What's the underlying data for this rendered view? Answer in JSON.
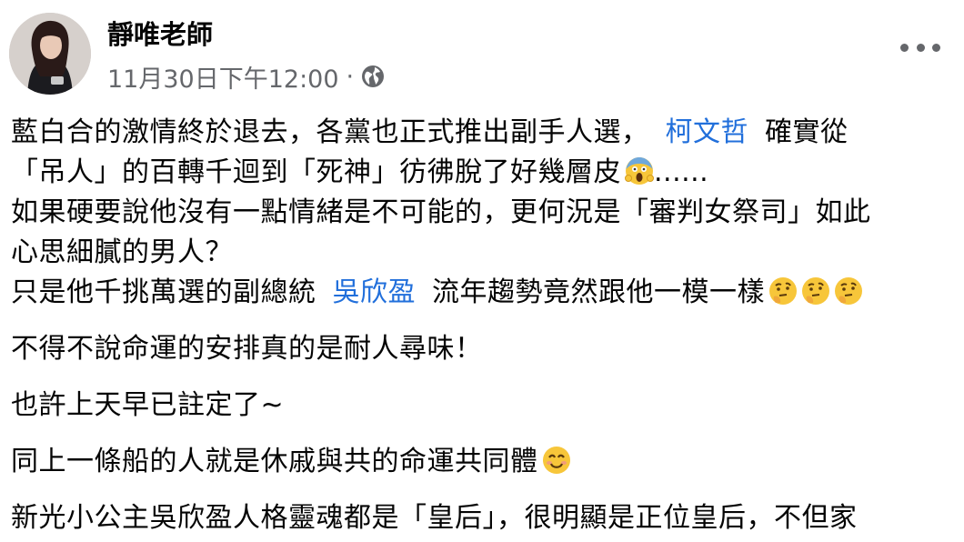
{
  "post": {
    "author": "靜唯老師",
    "timestamp": "11月30日下午12:00",
    "separator": "·",
    "privacy_icon": "globe-icon",
    "more_icon": "more-options-icon"
  },
  "content": {
    "l1_a": "藍白合的激情終於退去，各黨也正式推出副手人選，",
    "mention1": "柯文哲",
    "l1_b": "確實從",
    "l2_a": "「吊人」的百轉千迴到「死神」彷彿脫了好幾層皮",
    "l2_emoji": "face-screaming-in-fear",
    "l2_b": "......",
    "l3": "如果硬要說他沒有一點情緒是不可能的，更何況是「審判女祭司」如此",
    "l4": "心思細膩的男人？",
    "l5_a": "只是他千挑萬選的副總統",
    "mention2": "吳欣盈",
    "l5_b": "流年趨勢竟然跟他一模一樣",
    "l5_emoji": "thinking-face",
    "p2": "不得不說命運的安排真的是耐人尋味！",
    "p3": "也許上天早已註定了~",
    "p4": "同上一條船的人就是休戚與共的命運共同體",
    "p4_emoji": "smiling-face-with-smiling-eyes",
    "p5": "新光小公主吳欣盈人格靈魂都是「皇后」，很明顯是正位皇后，不但家"
  },
  "colors": {
    "link": "#216fdb",
    "meta": "#65676b",
    "text": "#050505"
  }
}
